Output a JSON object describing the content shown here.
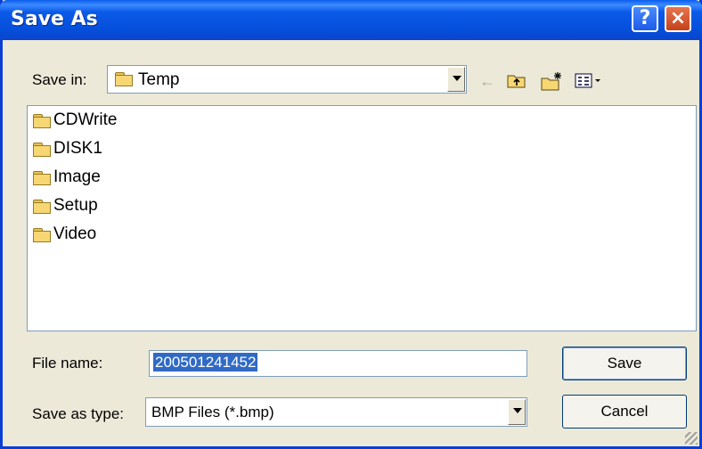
{
  "window": {
    "title": "Save As",
    "help_label": "?",
    "close_label": "×"
  },
  "toolbar": {
    "save_in_label": "Save in:",
    "save_in_value": "Temp",
    "icons": [
      "back-arrow-icon",
      "up-folder-icon",
      "new-folder-icon",
      "view-menu-icon"
    ]
  },
  "list": {
    "items": [
      {
        "label": "CDWrite",
        "icon": "folder-icon"
      },
      {
        "label": "DISK1",
        "icon": "folder-icon"
      },
      {
        "label": "Image",
        "icon": "folder-icon"
      },
      {
        "label": "Setup",
        "icon": "folder-icon"
      },
      {
        "label": "Video",
        "icon": "folder-icon"
      }
    ]
  },
  "form": {
    "file_name_label": "File name:",
    "file_name_value": "200501241452",
    "save_as_type_label": "Save as type:",
    "save_as_type_value": "BMP Files (*.bmp)"
  },
  "buttons": {
    "save_label": "Save",
    "cancel_label": "Cancel"
  },
  "colors": {
    "title_bar": "#0a5dec",
    "dialog_bg": "#ece9d8",
    "selection": "#316ac5"
  }
}
